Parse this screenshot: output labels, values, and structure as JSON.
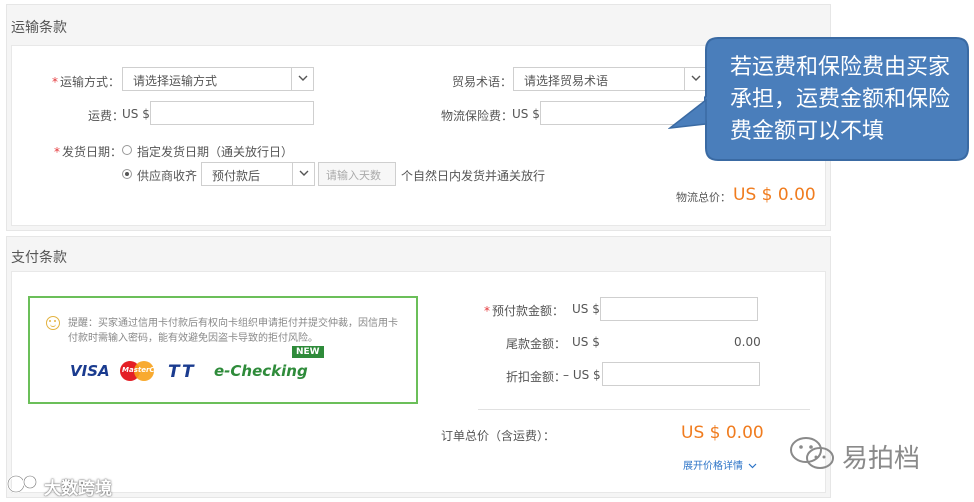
{
  "shipping": {
    "title": "运输条款",
    "method_label": "运输方式：",
    "method_placeholder": "请选择运输方式",
    "freight_label": "运费：",
    "freight_prefix": "US $",
    "trade_term_label": "贸易术语：",
    "trade_term_placeholder": "请选择贸易术语",
    "insurance_label": "物流保险费：",
    "insurance_prefix": "US $",
    "ship_date_label": "发货日期：",
    "option_specify": "指定发货日期（通关放行日）",
    "option_supplier": "供应商收齐",
    "supplier_select_value": "预付款后",
    "days_placeholder": "请输入天数",
    "days_suffix": "个自然日内发货并通关放行",
    "logistics_total_label": "物流总价：",
    "logistics_total_value": "US $ 0.00"
  },
  "payment": {
    "title": "支付条款",
    "notice_text": "提醒：买家通过信用卡付款后有权向卡组织申请拒付并提交仲裁，因信用卡付款时需输入密码，能有效避免因盗卡导致的拒付风险。",
    "cards": {
      "visa": "VISA",
      "mastercard": "MasterCard",
      "tt": "TT",
      "echecking": "e-Checking",
      "new_badge": "NEW"
    },
    "prepay_label": "预付款金额：",
    "prepay_prefix": "US $",
    "balance_label": "尾款金额：",
    "balance_prefix": "US $",
    "balance_value": "0.00",
    "discount_label": "折扣金额：",
    "discount_prefix": "– US $",
    "order_total_label": "订单总价（含运费）：",
    "order_total_value": "US $  0.00",
    "expand_link": "展开价格详情"
  },
  "callout": {
    "text": "若运费和保险费由买家承担，运费金额和保险费金额可以不填"
  },
  "watermarks": {
    "right": "易拍档",
    "left": "大数跨境"
  },
  "colors": {
    "accent_orange": "#f07c1f",
    "callout_blue": "#4a7ebb",
    "notice_green": "#6bbf59",
    "required_red": "#e4393c",
    "link_blue": "#2b73c7"
  }
}
